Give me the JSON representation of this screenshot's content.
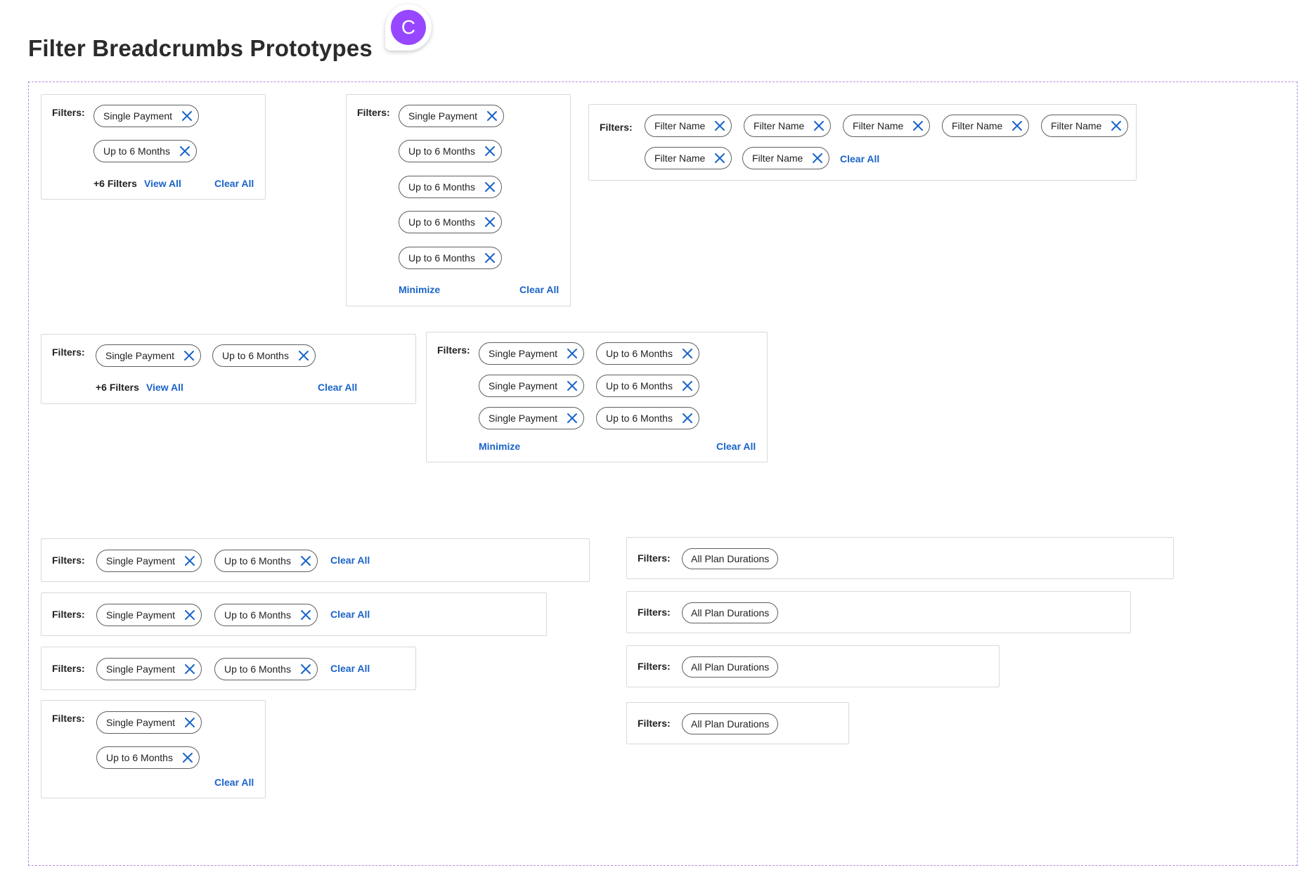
{
  "page": {
    "title": "Filter Breadcrumbs Prototypes",
    "avatar_initial": "C"
  },
  "colors": {
    "accent_link": "#1a64c8",
    "avatar": "#9747ff",
    "frame_border": "#b58ae8"
  },
  "icons": {
    "chip_remove": "close-icon"
  },
  "common": {
    "filters_label": "Filters:",
    "clear_all": "Clear All",
    "view_all": "View All",
    "minimize": "Minimize",
    "more_filters": "+6 Filters"
  },
  "chips": {
    "single_payment": "Single Payment",
    "up_to_6_months": "Up to 6 Months",
    "filter_name": "Filter Name",
    "all_plan_durations": "All Plan Durations"
  }
}
